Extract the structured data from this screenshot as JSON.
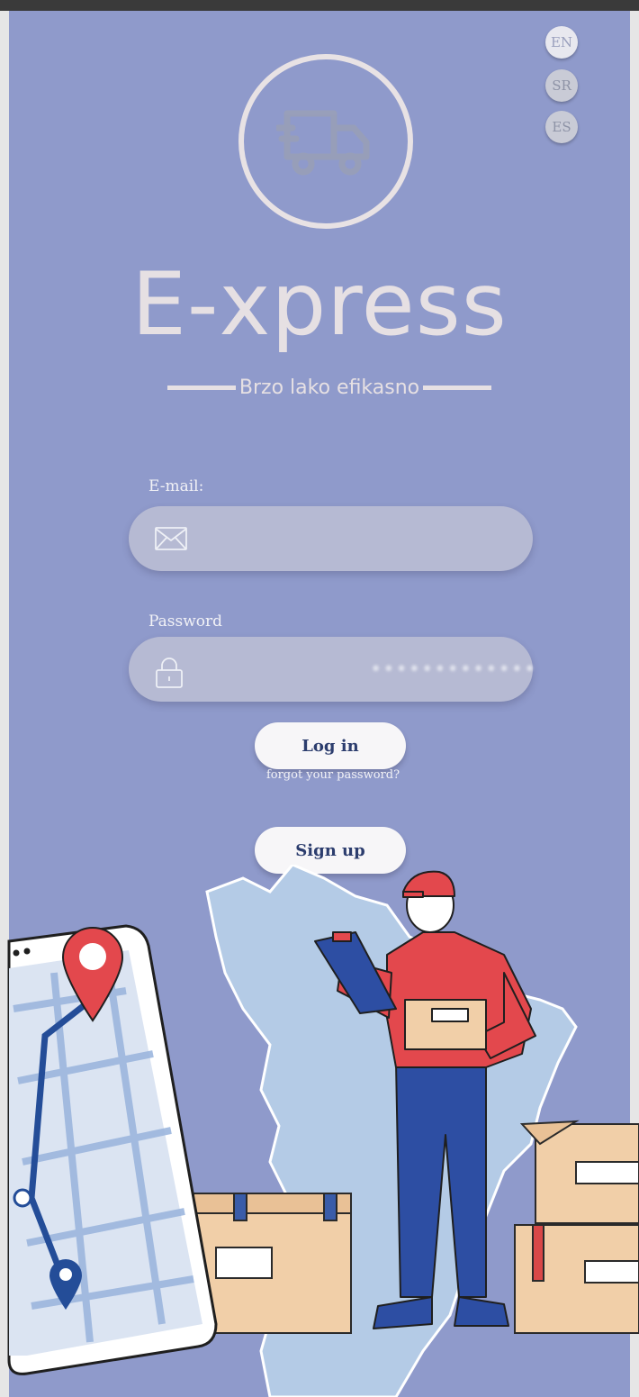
{
  "languages": [
    {
      "code": "EN",
      "active": true
    },
    {
      "code": "SR",
      "active": false
    },
    {
      "code": "ES",
      "active": false
    }
  ],
  "brand": {
    "title": "E-xpress",
    "tagline": "Brzo lako efikasno"
  },
  "login": {
    "email_label": "E-mail:",
    "email_value": "",
    "password_label": "Password",
    "password_mask": "•••••••••••••",
    "login_button": "Log in",
    "forgot_link": "forgot your password?",
    "signup_button": "Sign up"
  },
  "icons": {
    "logo": "truck-icon",
    "email": "envelope-icon",
    "password": "lock-icon",
    "illustration": "courier-delivery-illustration"
  },
  "colors": {
    "background": "#8f9acb",
    "field": "#b6bad3",
    "button": "#f7f6f8",
    "button_text": "#2c3d6e",
    "brand_text": "#e6e0e3"
  }
}
